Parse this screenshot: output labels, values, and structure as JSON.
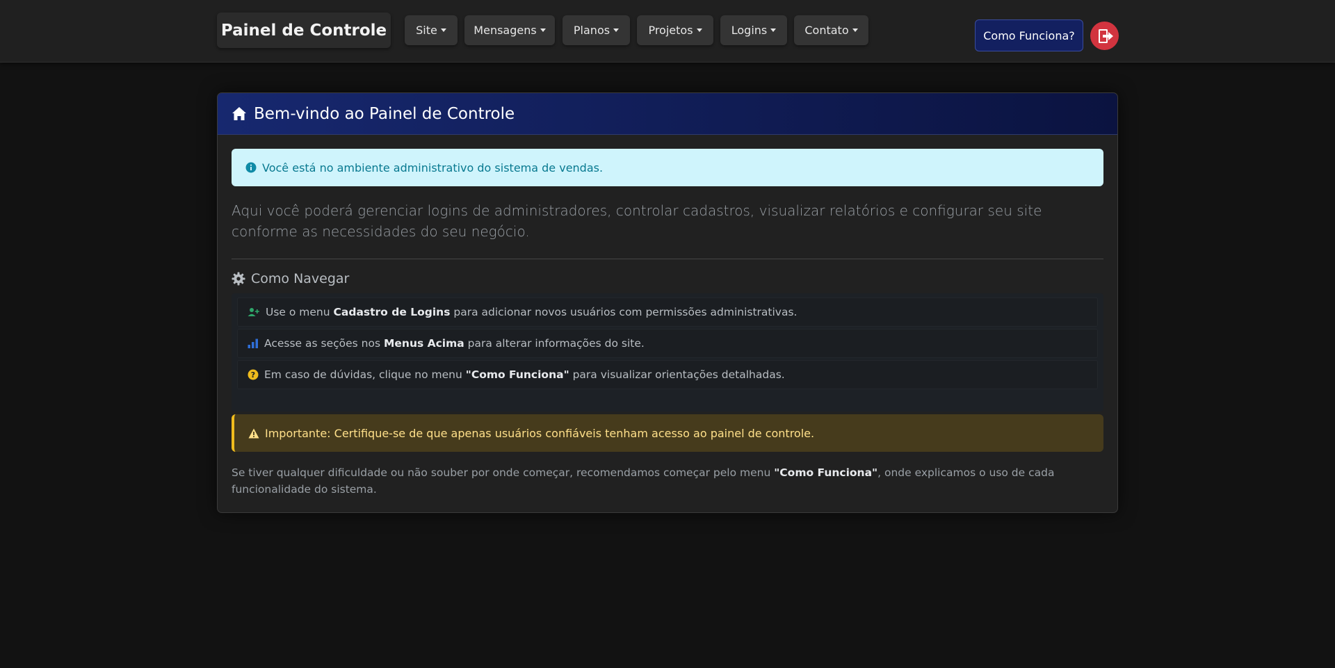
{
  "navbar": {
    "brand": "Painel de Controle",
    "items": [
      {
        "label": "Site"
      },
      {
        "label": "Mensagens"
      },
      {
        "label": "Planos"
      },
      {
        "label": "Projetos"
      },
      {
        "label": "Logins"
      },
      {
        "label": "Contato"
      }
    ],
    "how_button": "Como Funciona?",
    "logout_icon": "logout-icon"
  },
  "card": {
    "title": "Bem-vindo ao Painel de Controle",
    "title_icon": "home-icon",
    "info_alert": "Você está no ambiente administrativo do sistema de vendas.",
    "lead": "Aqui você poderá gerenciar logins de administradores, controlar cadastros, visualizar relatórios e configurar seu site conforme as necessidades do seu negócio.",
    "section_title": "Como Navegar",
    "section_icon": "gear-icon",
    "list": [
      {
        "icon": "user-plus-icon",
        "pre": "Use o menu ",
        "bold": "Cadastro de Logins",
        "post": " para adicionar novos usuários com permissões administrativas."
      },
      {
        "icon": "bar-chart-icon",
        "pre": "Acesse as seções nos ",
        "bold": "Menus Acima",
        "post": " para alterar informações do site."
      },
      {
        "icon": "question-icon",
        "pre": "Em caso de dúvidas, clique no menu ",
        "bold": "\"Como Funciona\"",
        "post": " para visualizar orientações detalhadas."
      }
    ],
    "warning_alert": "Importante: Certifique-se de que apenas usuários confiáveis tenham acesso ao painel de controle.",
    "footnote": {
      "pre": "Se tiver qualquer dificuldade ou não souber por onde começar, recomendamos começar pelo menu ",
      "bold": "\"Como Funciona\"",
      "post": ", onde explicamos o uso de cada funcionalidade do sistema."
    }
  },
  "colors": {
    "background": "#121212",
    "header_gradient_start": "#17286f",
    "info_bg": "#cff4fc",
    "warning_border": "#f0bc1d",
    "logout_red": "#d2343f"
  }
}
